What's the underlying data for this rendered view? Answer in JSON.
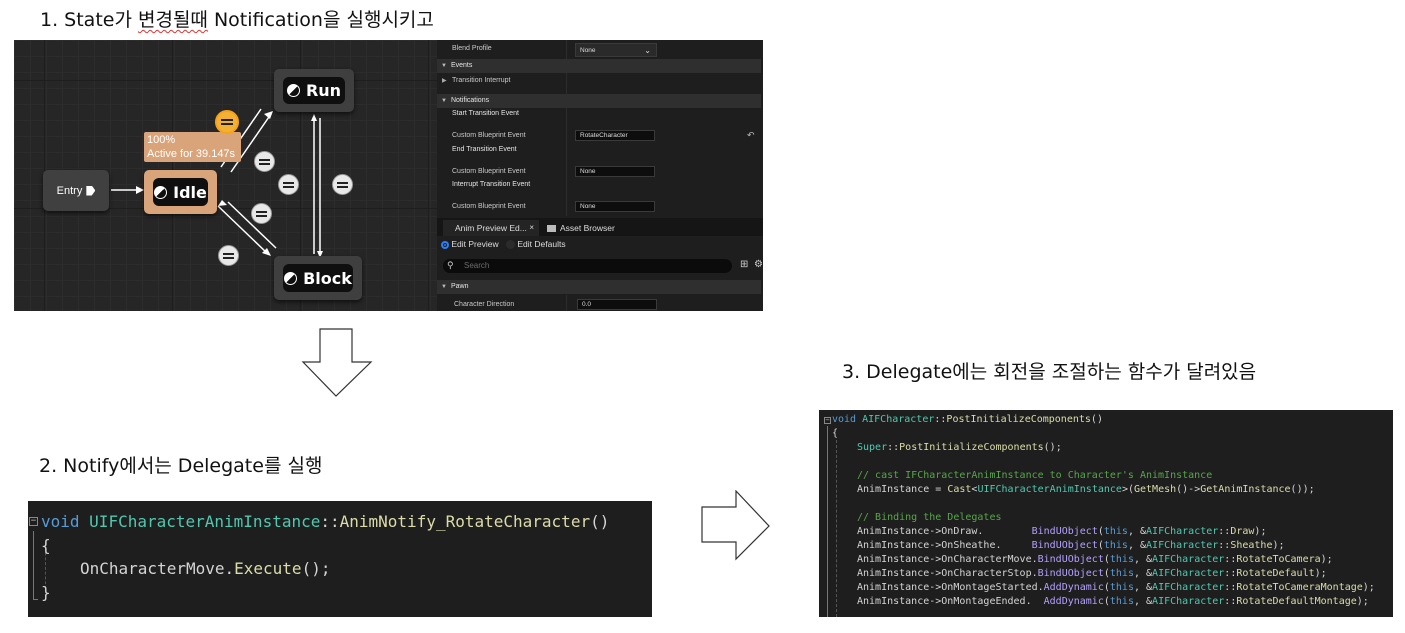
{
  "captions": {
    "step1_prefix": "1. State가 ",
    "step1_underlined": "변경될때",
    "step1_suffix": " Notification을 실행시키고",
    "step2": "2. Notify에서는 Delegate를 실행",
    "step3": "3. Delegate에는 회전을 조절하는 함수가 달려있음"
  },
  "graph": {
    "entry_label": "Entry",
    "nodes": {
      "idle": "Idle",
      "run": "Run",
      "block": "Block"
    },
    "tooltip": {
      "percent": "100%",
      "active": "Active for 39.147s"
    }
  },
  "details": {
    "blend_profile_label": "Blend Profile",
    "blend_profile_value": "None",
    "events_header": "Events",
    "transition_interrupt": "Transition Interrupt",
    "notifications_header": "Notifications",
    "start_transition_event": "Start Transition Event",
    "custom_blueprint_event": "Custom Blueprint Event",
    "start_value": "RotateCharacter",
    "end_transition_event": "End Transition Event",
    "end_value": "None",
    "interrupt_transition_event": "Interrupt Transition Event",
    "interrupt_value": "None",
    "tab_anim_preview": "Anim Preview Ed...",
    "tab_asset_browser": "Asset Browser",
    "radio_edit_preview": "Edit Preview",
    "radio_edit_defaults": "Edit Defaults",
    "search_placeholder": "Search",
    "pawn_header": "Pawn",
    "character_direction_label": "Character Direction",
    "character_direction_value": "0.0"
  },
  "code_notify": {
    "l1": {
      "kw": "void",
      "cls": "UIFCharacterAnimInstance",
      "sep": "::",
      "fn": "AnimNotify_RotateCharacter",
      "end": "()"
    },
    "l2": "{",
    "l3": {
      "obj": "OnCharacterMove.",
      "fn": "Execute",
      "end": "();"
    },
    "l4": "}"
  },
  "code_bind": {
    "l1": {
      "kw": "void",
      "cls": "AIFCharacter",
      "sep": "::",
      "fn": "PostInitializeComponents",
      "end": "()"
    },
    "l2": "{",
    "l3": {
      "cls": "Super",
      "sep": "::",
      "fn": "PostInitializeComponents",
      "end": "();"
    },
    "l5": "// cast IFCharacterAnimInstance to Character's AnimInstance",
    "l6": {
      "a": "AnimInstance = ",
      "fn1": "Cast",
      "lt": "<",
      "ty": "UIFCharacterAnimInstance",
      "gt": ">(",
      "fn2": "GetMesh",
      "mid": "()->",
      "fn3": "GetAnimInstance",
      "end": "());"
    },
    "l8": "// Binding the Delegates",
    "binds": [
      {
        "lhs": "AnimInstance->OnDraw.        ",
        "mac": "BindUObject",
        "open": "(",
        "this": "this",
        "amp": ", &",
        "cls": "AIFCharacter",
        "sep": "::",
        "fn": "Draw",
        "end": ");"
      },
      {
        "lhs": "AnimInstance->OnSheathe.     ",
        "mac": "BindUObject",
        "open": "(",
        "this": "this",
        "amp": ", &",
        "cls": "AIFCharacter",
        "sep": "::",
        "fn": "Sheathe",
        "end": ");"
      },
      {
        "lhs": "AnimInstance->OnCharacterMove.",
        "mac": "BindUObject",
        "open": "(",
        "this": "this",
        "amp": ", &",
        "cls": "AIFCharacter",
        "sep": "::",
        "fn": "RotateToCamera",
        "end": ");"
      },
      {
        "lhs": "AnimInstance->OnCharacterStop.",
        "mac": "BindUObject",
        "open": "(",
        "this": "this",
        "amp": ", &",
        "cls": "AIFCharacter",
        "sep": "::",
        "fn": "RotateDefault",
        "end": ");"
      },
      {
        "lhs": "AnimInstance->OnMontageStarted.",
        "mac": "AddDynamic",
        "open": "(",
        "this": "this",
        "amp": ", &",
        "cls": "AIFCharacter",
        "sep": "::",
        "fn": "RotateToCameraMontage",
        "end": ");"
      },
      {
        "lhs": "AnimInstance->OnMontageEnded.  ",
        "mac": "AddDynamic",
        "open": "(",
        "this": "this",
        "amp": ", &",
        "cls": "AIFCharacter",
        "sep": "::",
        "fn": "RotateDefaultMontage",
        "end": ");"
      }
    ]
  },
  "colors": {
    "keyword": "#569cd6",
    "type": "#4ec9b0",
    "function": "#dcdcaa",
    "comment": "#57a64a",
    "idle_node": "#d9a47a",
    "selected_transition": "#f2b133"
  }
}
